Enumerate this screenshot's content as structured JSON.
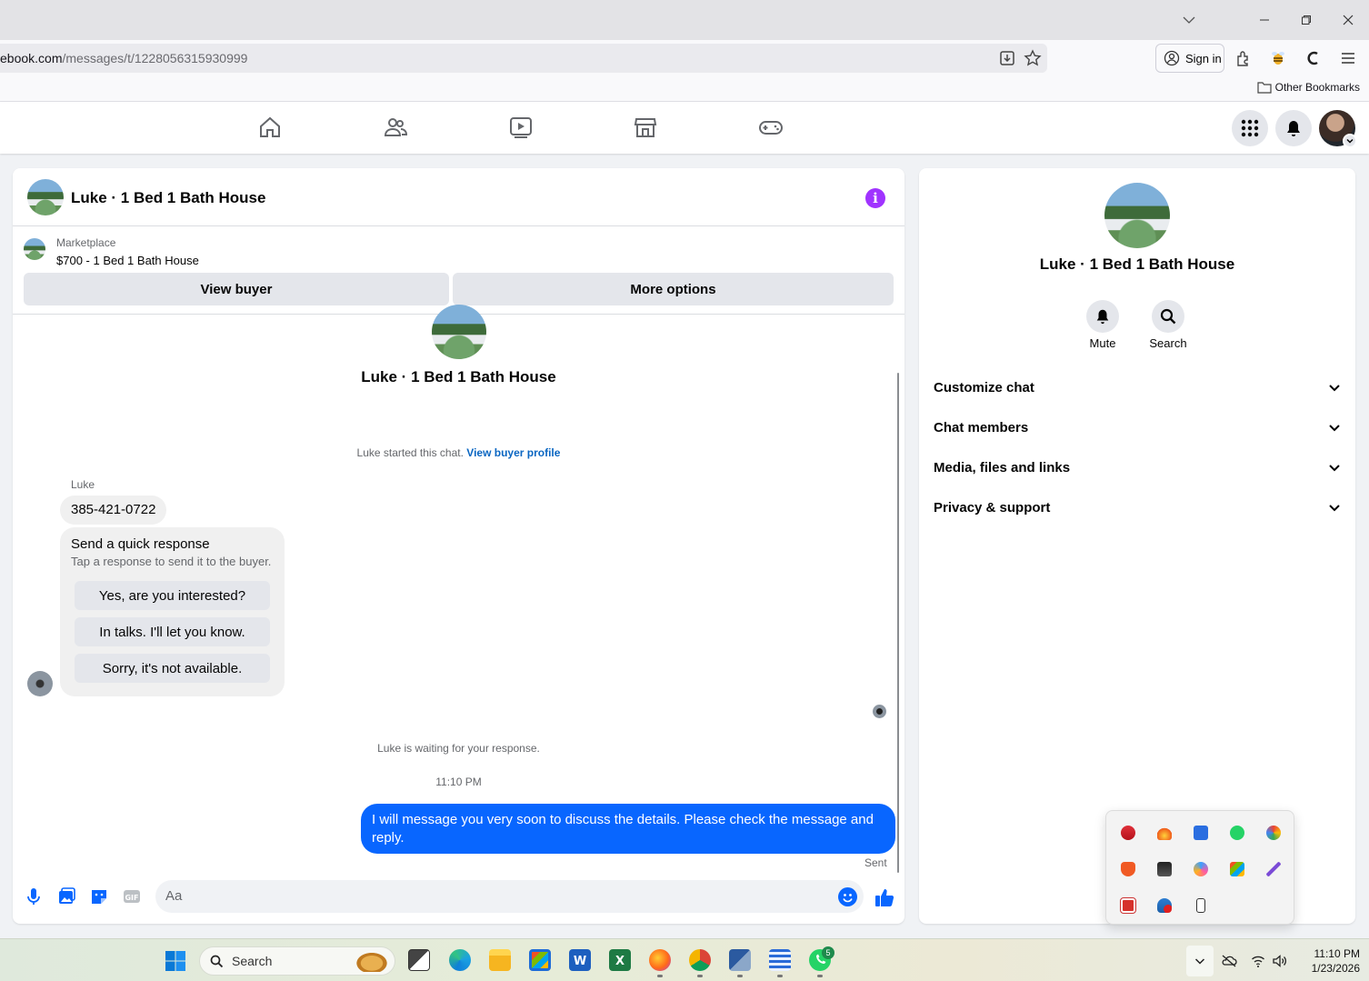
{
  "browser": {
    "url_host": "ebook.com",
    "url_path": "/messages/t/1228056315930999",
    "sign_in_label": "Sign in",
    "other_bookmarks_label": "Other Bookmarks"
  },
  "chat": {
    "title": "Luke · 1 Bed 1 Bath House",
    "marketplace_label": "Marketplace",
    "listing": "$700 - 1 Bed 1 Bath House",
    "view_buyer_label": "View buyer",
    "more_options_label": "More options",
    "convo_name": "Luke · 1 Bed 1 Bath House",
    "started_text": "Luke started this chat.",
    "view_buyer_profile_link": "View buyer profile",
    "sender_name": "Luke",
    "phone_message": "385-421-0722",
    "quick_response": {
      "title": "Send a quick response",
      "subtitle": "Tap a response to send it to the buyer.",
      "options": [
        "Yes, are you interested?",
        "In talks. I'll let you know.",
        "Sorry, it's not available."
      ]
    },
    "waiting_text": "Luke is waiting for your response.",
    "timestamp": "11:10 PM",
    "my_message": "I will message you very soon to discuss the details. Please check the message and reply.",
    "sent_label": "Sent",
    "input_placeholder": "Aa",
    "accent_color": "#0866ff"
  },
  "info": {
    "name": "Luke · 1 Bed 1 Bath House",
    "mute_label": "Mute",
    "search_label": "Search",
    "sections": [
      "Customize chat",
      "Chat members",
      "Media, files and links",
      "Privacy & support"
    ]
  },
  "taskbar": {
    "search_label": "Search",
    "whatsapp_badge": "5",
    "time": "11:10 PM",
    "date": "1/23/2026"
  }
}
